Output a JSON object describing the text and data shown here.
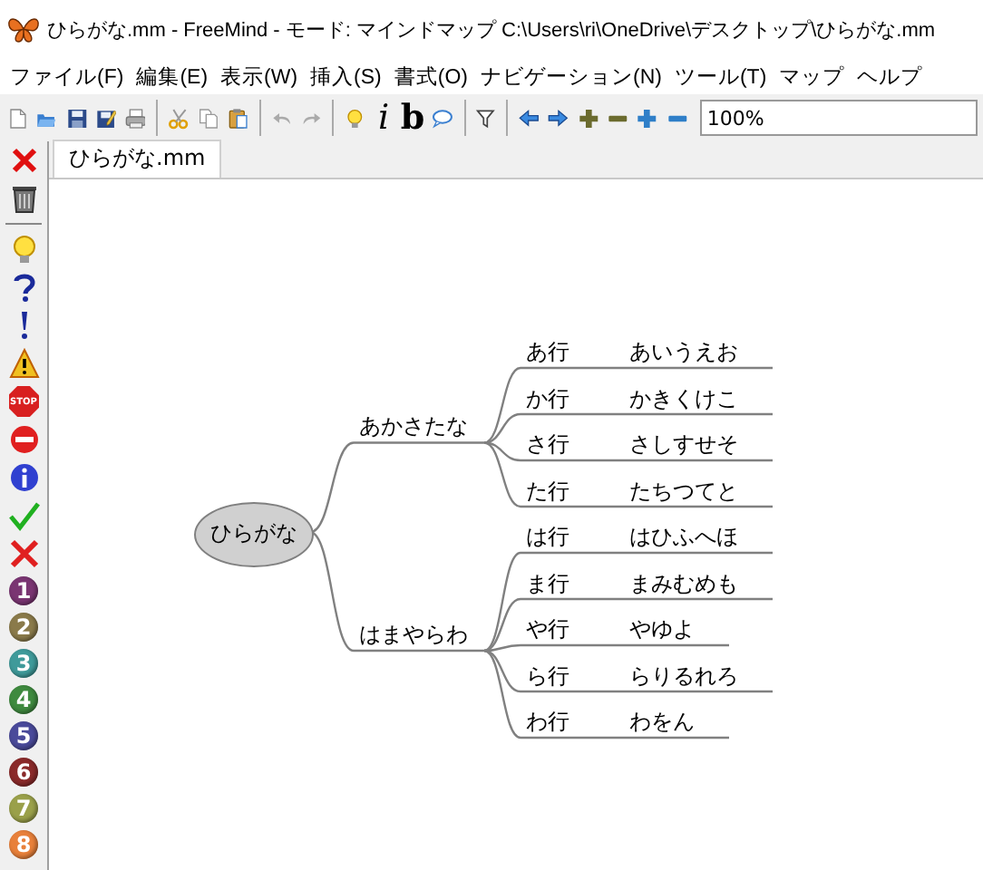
{
  "window": {
    "title": "ひらがな.mm - FreeMind - モード: マインドマップ C:\\Users\\ri\\OneDrive\\デスクトップ\\ひらがな.mm"
  },
  "menu": [
    "ファイル(F)",
    "編集(E)",
    "表示(W)",
    "挿入(S)",
    "書式(O)",
    "ナビゲーション(N)",
    "ツール(T)",
    "マップ",
    "ヘルプ"
  ],
  "toolbar": [
    {
      "kind": "new"
    },
    {
      "kind": "open"
    },
    {
      "kind": "save"
    },
    {
      "kind": "saveas"
    },
    {
      "kind": "print"
    },
    {
      "kind": "separator"
    },
    {
      "kind": "cut"
    },
    {
      "kind": "copy"
    },
    {
      "kind": "paste"
    },
    {
      "kind": "separator"
    },
    {
      "kind": "undo",
      "disabled": true
    },
    {
      "kind": "redo",
      "disabled": true
    },
    {
      "kind": "separator"
    },
    {
      "kind": "bulb"
    },
    {
      "kind": "italic",
      "label": "i"
    },
    {
      "kind": "bold",
      "label": "b"
    },
    {
      "kind": "bubble"
    },
    {
      "kind": "separator"
    },
    {
      "kind": "filter"
    },
    {
      "kind": "separator"
    },
    {
      "kind": "left"
    },
    {
      "kind": "right"
    },
    {
      "kind": "plus",
      "color": "#6b6b2e"
    },
    {
      "kind": "minus",
      "color": "#6b6b2e"
    },
    {
      "kind": "plus",
      "color": "#2f7fc8"
    },
    {
      "kind": "minus",
      "color": "#2f7fc8"
    }
  ],
  "zoom": {
    "value": "100%"
  },
  "tabs": [
    {
      "label": "ひらがな.mm",
      "selected": true
    }
  ],
  "icon_bar": [
    {
      "kind": "close"
    },
    {
      "kind": "trash"
    },
    {
      "kind": "separator"
    },
    {
      "kind": "bulb"
    },
    {
      "kind": "question"
    },
    {
      "kind": "exclamation"
    },
    {
      "kind": "warning"
    },
    {
      "kind": "stop",
      "label": "STOP"
    },
    {
      "kind": "noentry"
    },
    {
      "kind": "info"
    },
    {
      "kind": "check"
    },
    {
      "kind": "cross"
    },
    {
      "kind": "number",
      "label": "1",
      "color": "#7a3572"
    },
    {
      "kind": "number",
      "label": "2",
      "color": "#8a7a4a"
    },
    {
      "kind": "number",
      "label": "3",
      "color": "#3f9a9a"
    },
    {
      "kind": "number",
      "label": "4",
      "color": "#3f8a3f"
    },
    {
      "kind": "number",
      "label": "5",
      "color": "#4a4a9a"
    },
    {
      "kind": "number",
      "label": "6",
      "color": "#8a2a2a"
    },
    {
      "kind": "number",
      "label": "7",
      "color": "#9aa04a"
    },
    {
      "kind": "number",
      "label": "8",
      "color": "#e8803a"
    }
  ],
  "mindmap": {
    "root": {
      "text": "ひらがな",
      "children": [
        {
          "text": "あかさたな",
          "children": [
            {
              "text": "あ行",
              "children": [
                {
                  "text": "あいうえお"
                }
              ]
            },
            {
              "text": "か行",
              "children": [
                {
                  "text": "かきくけこ"
                }
              ]
            },
            {
              "text": "さ行",
              "children": [
                {
                  "text": "さしすせそ"
                }
              ]
            },
            {
              "text": "た行",
              "children": [
                {
                  "text": "たちつてと"
                }
              ]
            }
          ]
        },
        {
          "text": "はまやらわ",
          "children": [
            {
              "text": "は行",
              "children": [
                {
                  "text": "はひふへほ"
                }
              ]
            },
            {
              "text": "ま行",
              "children": [
                {
                  "text": "まみむめも"
                }
              ]
            },
            {
              "text": "や行",
              "children": [
                {
                  "text": "やゆよ"
                }
              ]
            },
            {
              "text": "ら行",
              "children": [
                {
                  "text": "らりるれろ"
                }
              ]
            },
            {
              "text": "わ行",
              "children": [
                {
                  "text": "わをん"
                }
              ]
            }
          ]
        }
      ]
    }
  }
}
